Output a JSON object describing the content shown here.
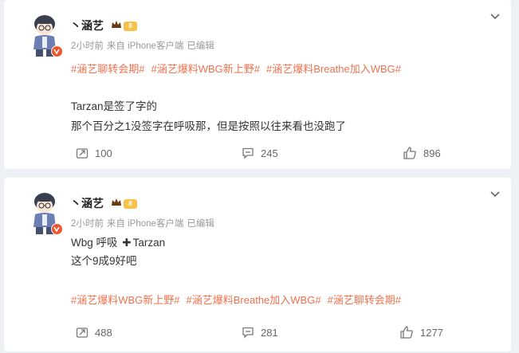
{
  "posts": [
    {
      "user": {
        "name": "丶涵艺",
        "level": "8"
      },
      "meta": {
        "time": "2小时前",
        "source": "来自 iPhone客户端",
        "edited": "已编辑"
      },
      "tags": [
        "#涵艺聊转会期#",
        "#涵艺爆料WBG新上野#",
        "#涵艺爆料Breathe加入WBG#"
      ],
      "lines": [
        "Tarzan是签了字的",
        "那个百分之1没签字在呼吸那，但是按照以往来看也没跑了"
      ],
      "actions": {
        "repost": "100",
        "comment": "245",
        "like": "896"
      }
    },
    {
      "user": {
        "name": "丶涵艺",
        "level": "8"
      },
      "meta": {
        "time": "2小时前",
        "source": "来自 iPhone客户端",
        "edited": "已编辑"
      },
      "line1_part1": "Wbg 呼吸",
      "line1_plus": "✚",
      "line1_part2": "Tarzan",
      "line2": "这个9成9好吧",
      "tags": [
        "#涵艺爆料WBG新上野#",
        "#涵艺爆料Breathe加入WBG#",
        "#涵艺聊转会期#"
      ],
      "actions": {
        "repost": "488",
        "comment": "281",
        "like": "1277"
      }
    }
  ],
  "icons": {
    "more": "chevron-down-icon",
    "repost": "share-icon",
    "comment": "comment-icon",
    "like": "thumbs-up-icon"
  },
  "colors": {
    "tag": "#eb7350",
    "badge": "#f0552d",
    "level": "#f6c24a"
  }
}
